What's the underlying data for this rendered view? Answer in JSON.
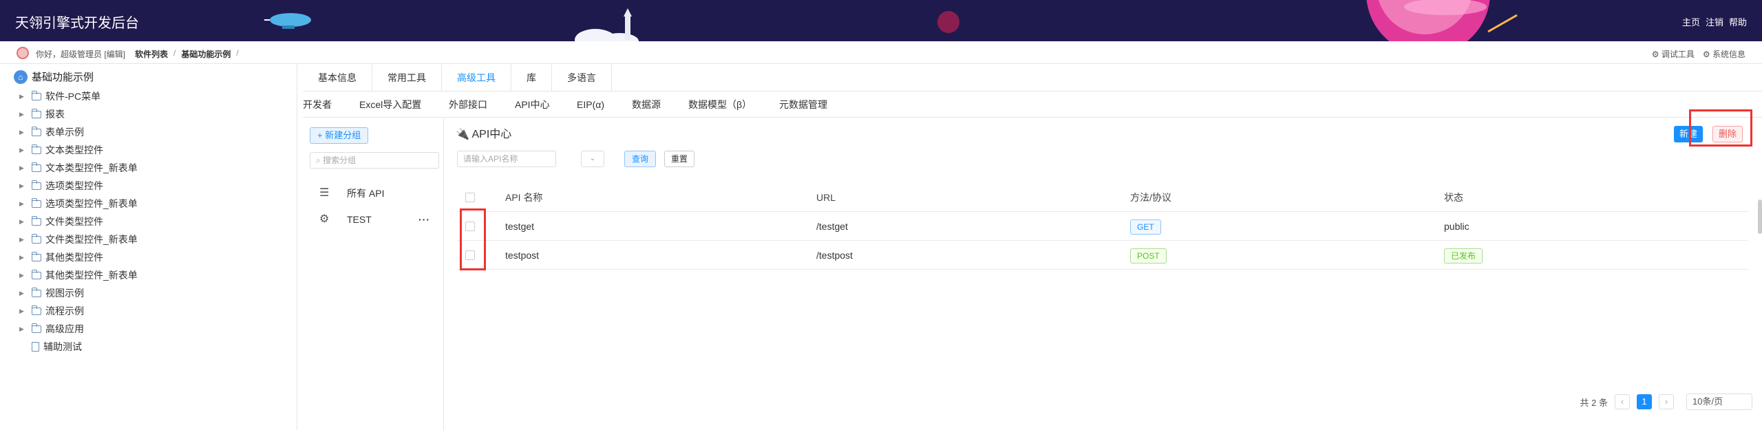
{
  "header": {
    "title": "天翎引擎式开发后台",
    "nav": [
      "主页",
      "注销",
      "帮助"
    ],
    "colors": {
      "background": "#1f1a4d",
      "planet": "#e0399a"
    }
  },
  "subbar": {
    "greeting": "你好，超级管理员 [编辑]",
    "breadcrumb": [
      "软件列表",
      "基础功能示例"
    ],
    "tools": [
      "调试工具",
      "系统信息"
    ]
  },
  "tree": {
    "root": "基础功能示例",
    "items": [
      {
        "label": "软件-PC菜单",
        "type": "folder"
      },
      {
        "label": "报表",
        "type": "folder"
      },
      {
        "label": "表单示例",
        "type": "folder"
      },
      {
        "label": "文本类型控件",
        "type": "folder"
      },
      {
        "label": "文本类型控件_新表单",
        "type": "folder"
      },
      {
        "label": "选项类型控件",
        "type": "folder"
      },
      {
        "label": "选项类型控件_新表单",
        "type": "folder"
      },
      {
        "label": "文件类型控件",
        "type": "folder"
      },
      {
        "label": "文件类型控件_新表单",
        "type": "folder"
      },
      {
        "label": "其他类型控件",
        "type": "folder"
      },
      {
        "label": "其他类型控件_新表单",
        "type": "folder"
      },
      {
        "label": "视图示例",
        "type": "folder"
      },
      {
        "label": "流程示例",
        "type": "folder"
      },
      {
        "label": "高级应用",
        "type": "folder"
      },
      {
        "label": "辅助测试",
        "type": "doc"
      }
    ]
  },
  "tabs": [
    "基本信息",
    "常用工具",
    "高级工具",
    "库",
    "多语言"
  ],
  "active_tab": "高级工具",
  "subtabs": [
    "开发者",
    "Excel导入配置",
    "外部接口",
    "API中心",
    "EIP(α)",
    "数据源",
    "数据模型（β）",
    "元数据管理"
  ],
  "groups": {
    "new_label": "+ 新建分组",
    "search_placeholder": "搜索分组",
    "items": [
      {
        "label": "所有 API",
        "icon": "menu-icon"
      },
      {
        "label": "TEST",
        "icon": "api-group-icon",
        "more": "···"
      }
    ]
  },
  "content": {
    "title": "API中心",
    "new_label": "新建",
    "delete_label": "删除",
    "search_placeholder": "请输入API名称",
    "query_label": "查询",
    "reset_label": "重置",
    "table": {
      "headers": [
        "API 名称",
        "URL",
        "方法/协议",
        "状态"
      ],
      "rows": [
        {
          "name": "testget",
          "url": "/testget",
          "method": "GET",
          "status": "public"
        },
        {
          "name": "testpost",
          "url": "/testpost",
          "method": "POST",
          "status": "已发布"
        }
      ]
    },
    "pager": {
      "total": "共 2 条",
      "page": "1",
      "size": "10条/页"
    }
  }
}
